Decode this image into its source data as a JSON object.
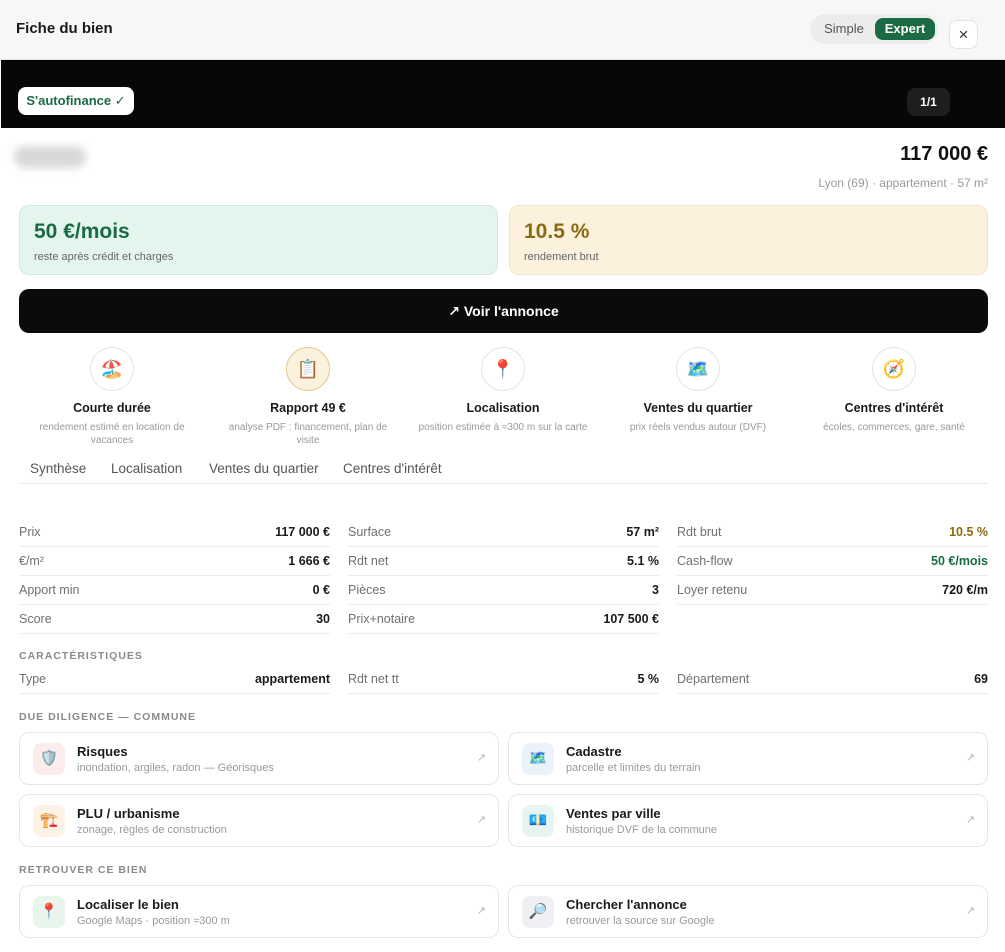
{
  "header": {
    "title": "Fiche du bien",
    "mode_simple": "Simple",
    "mode_expert": "Expert",
    "close": "×"
  },
  "banner": {
    "badge": "S'autofinance ✓",
    "counter": "1/1"
  },
  "summary": {
    "price": "117 000 €",
    "subline": "Lyon (69) · appartement · 57 m²"
  },
  "kpis": {
    "cashflow_value": "50 €/mois",
    "cashflow_label": "reste après crédit et charges",
    "yield_value": "10.5 %",
    "yield_label": "rendement brut"
  },
  "cta": {
    "label": "↗ Voir l'annonce"
  },
  "features": [
    {
      "icon": "🏖️",
      "title": "Courte durée",
      "desc": "rendement estimé en location de vacances"
    },
    {
      "icon": "📋",
      "title": "Rapport 49 €",
      "desc": "analyse PDF : financement, plan de visite"
    },
    {
      "icon": "📍",
      "title": "Localisation",
      "desc": "position estimée à ≈300 m sur la carte"
    },
    {
      "icon": "🗺️",
      "title": "Ventes du quartier",
      "desc": "prix réels vendus autour (DVF)"
    },
    {
      "icon": "🧭",
      "title": "Centres d'intérêt",
      "desc": "écoles, commerces, gare, santé"
    }
  ],
  "tabs": [
    "Synthèse",
    "Localisation",
    "Ventes du quartier",
    "Centres d'intérêt"
  ],
  "metrics": {
    "col1": [
      {
        "k": "Prix",
        "v": "117 000 €"
      },
      {
        "k": "€/m²",
        "v": "1 666 €"
      },
      {
        "k": "Apport min",
        "v": "0 €"
      },
      {
        "k": "Score",
        "v": "30"
      }
    ],
    "col2": [
      {
        "k": "Surface",
        "v": "57 m²"
      },
      {
        "k": "Rdt net",
        "v": "5.1 %"
      },
      {
        "k": "Pièces",
        "v": "3"
      },
      {
        "k": "Prix+notaire",
        "v": "107 500 €"
      }
    ],
    "col3": [
      {
        "k": "Rdt brut",
        "v": "10.5 %"
      },
      {
        "k": "Cash-flow",
        "v": "50 €/mois"
      },
      {
        "k": "Loyer retenu",
        "v": "720 €/m"
      }
    ]
  },
  "caracteristiques": {
    "heading": "CARACTÉRISTIQUES",
    "rows": [
      {
        "k": "Type",
        "v": "appartement"
      },
      {
        "k": "Rdt net tt",
        "v": "5 %"
      },
      {
        "k": "Département",
        "v": "69"
      }
    ]
  },
  "due_diligence": {
    "heading": "DUE DILIGENCE — COMMUNE",
    "cards": [
      {
        "icon": "🛡️",
        "title": "Risques",
        "desc": "inondation, argiles, radon — Géorisques",
        "arrow": "↗"
      },
      {
        "icon": "🗺️",
        "title": "Cadastre",
        "desc": "parcelle et limites du terrain",
        "arrow": "↗"
      },
      {
        "icon": "🏗️",
        "title": "PLU / urbanisme",
        "desc": "zonage, règles de construction",
        "arrow": "↗"
      },
      {
        "icon": "💶",
        "title": "Ventes par ville",
        "desc": "historique DVF de la commune",
        "arrow": "↗"
      }
    ]
  },
  "retrouver": {
    "heading": "RETROUVER CE BIEN",
    "cards": [
      {
        "icon": "📍",
        "title": "Localiser le bien",
        "desc": "Google Maps · position ≈300 m",
        "arrow": "↗"
      },
      {
        "icon": "🔎",
        "title": "Chercher l'annonce",
        "desc": "retrouver la source sur Google",
        "arrow": "↗"
      }
    ]
  },
  "colors": {
    "accent_green": "#1a6b44",
    "accent_gold": "#8a6b12",
    "banner_bg": "#070707"
  }
}
